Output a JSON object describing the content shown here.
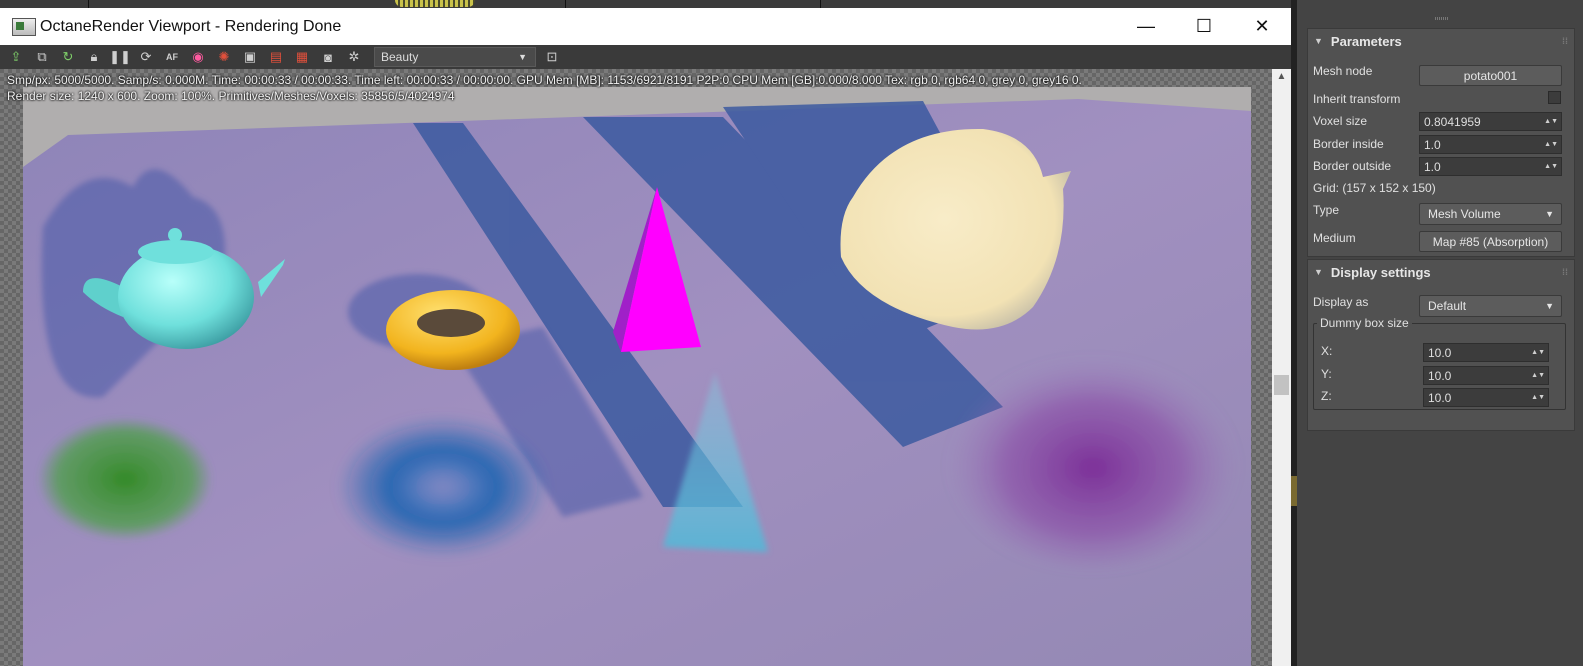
{
  "window": {
    "title": "OctaneRender Viewport - Rendering Done",
    "minimize": "—",
    "maximize": "☐",
    "close": "✕"
  },
  "toolbar": {
    "pass": "Beauty",
    "icons": [
      "export-icon",
      "copy-icon",
      "restart-icon",
      "lock-icon",
      "pause-icon",
      "refresh-icon",
      "af-icon",
      "color-picker-icon",
      "material-picker-icon",
      "region-icon",
      "film-icon",
      "camera-icon",
      "render-icon",
      "settings-gear-icon",
      "viewport-icon"
    ],
    "af_label": "AF"
  },
  "stats": {
    "line1": "Smp/px: 5000/5000.  Samp/s: 0.000M.  Time: 00:00:33 / 00:00:33.  Time left: 00:00:33 / 00:00:00.  GPU Mem [MB]: 1153/6921/8191 P2P:0  CPU Mem [GB]:0.000/8.000  Tex: rgb 0, rgb64 0, grey 0, grey16 0.",
    "line2": "Render size: 1240 x 600.  Zoom: 100%.  Primitives/Meshes/Voxels: 35856/5/4024974"
  },
  "parameters": {
    "header": "Parameters",
    "mesh_node_label": "Mesh node",
    "mesh_node_value": "potato001",
    "inherit_transform_label": "Inherit transform",
    "voxel_size_label": "Voxel size",
    "voxel_size_value": "0.8041959",
    "border_inside_label": "Border inside",
    "border_inside_value": "1.0",
    "border_outside_label": "Border outside",
    "border_outside_value": "1.0",
    "grid_label": "Grid: (157 x 152 x 150)",
    "type_label": "Type",
    "type_value": "Mesh Volume",
    "medium_label": "Medium",
    "medium_value": "Map #85 (Absorption)"
  },
  "display_settings": {
    "header": "Display settings",
    "display_as_label": "Display as",
    "display_as_value": "Default",
    "dummy_box_label": "Dummy box size",
    "x_label": "X:",
    "x_value": "10.0",
    "y_label": "Y:",
    "y_value": "10.0",
    "z_label": "Z:",
    "z_value": "10.0"
  },
  "colors": {
    "floor": "#9488b4",
    "teapot": "#6fe0dc",
    "torus": "#f2b41e",
    "pyramid": "#ff00ff",
    "potato": "#f2e2b4",
    "volume_teapot": "#3a8a2a",
    "volume_torus": "#1a62b0",
    "volume_potato": "#7a2a96"
  }
}
